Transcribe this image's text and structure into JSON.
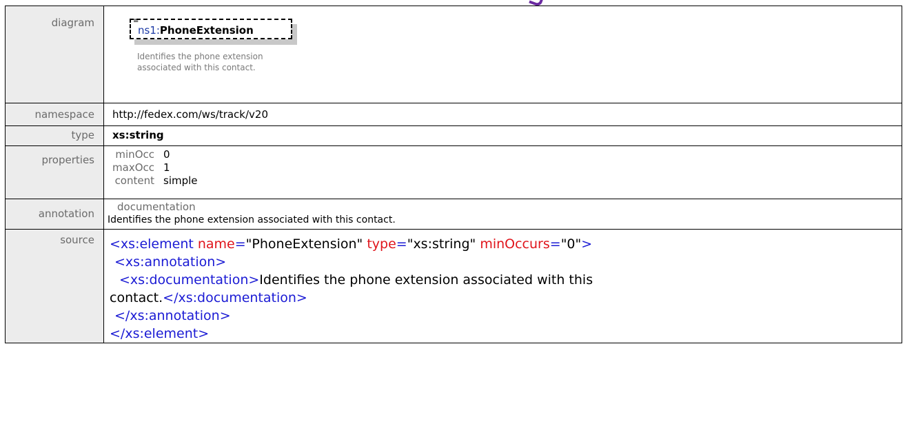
{
  "labels": {
    "diagram": "diagram",
    "namespace": "namespace",
    "type": "type",
    "properties": "properties",
    "annotation": "annotation",
    "source": "source"
  },
  "diagram": {
    "prefix": "ns1:",
    "name": "PhoneExtension",
    "description": "Identifies the phone extension associated with this contact."
  },
  "namespace": "http://fedex.com/ws/track/v20",
  "type": "xs:string",
  "properties": [
    {
      "key": "minOcc",
      "value": "0"
    },
    {
      "key": "maxOcc",
      "value": "1"
    },
    {
      "key": "content",
      "value": "simple"
    }
  ],
  "annotation": {
    "title": "documentation",
    "text": "Identifies the phone extension associated with this contact."
  },
  "source": {
    "l1_open": "<xs:element",
    "l1_attr1": "name",
    "l1_val1": "\"PhoneExtension\"",
    "l1_attr2": "type",
    "l1_val2": "\"xs:string\"",
    "l1_attr3": "minOccurs",
    "l1_val3": "\"0\"",
    "l1_close": ">",
    "l2": "<xs:annotation>",
    "l3_open": "<xs:documentation>",
    "l3_text": "Identifies the phone extension associated with this",
    "l4_text": "contact.",
    "l4_close": "</xs:documentation>",
    "l5": "</xs:annotation>",
    "l6": "</xs:element>",
    "eq": "="
  },
  "colors": {
    "tag": "#1a1ad4",
    "attr": "#e0141b",
    "attr_value": "#8b1414",
    "label_bg": "#ececec"
  }
}
